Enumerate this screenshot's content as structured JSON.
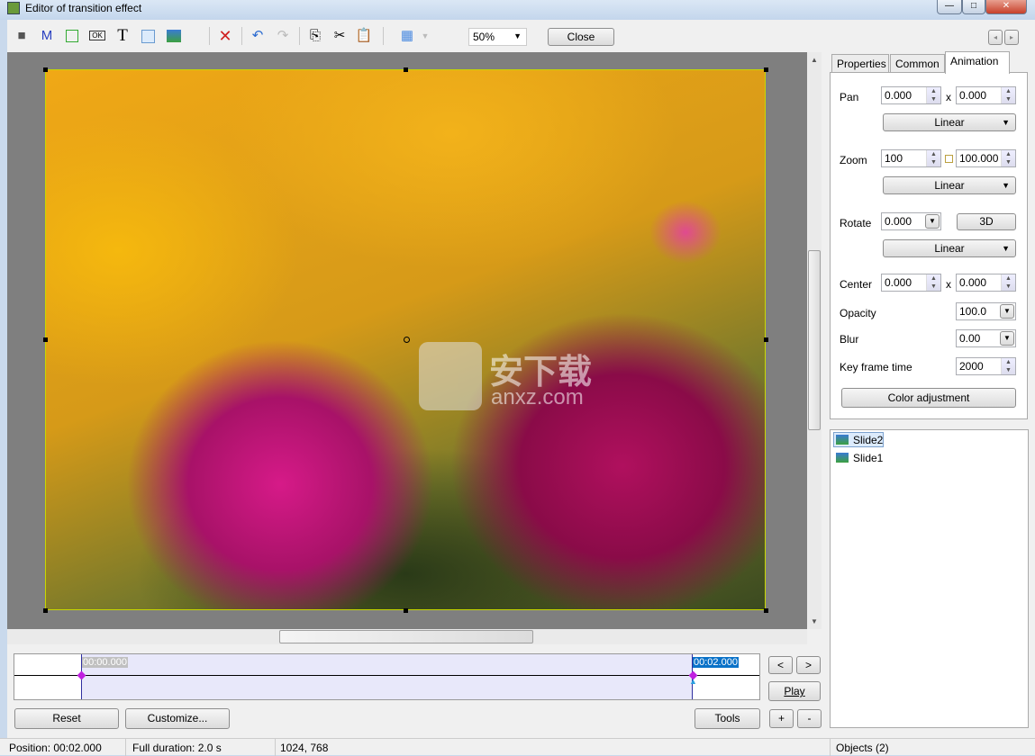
{
  "window": {
    "title": "Editor of transition effect",
    "minimize": "—",
    "maximize": "□",
    "close": "✕"
  },
  "toolbar": {
    "icons": [
      "camera-icon",
      "mask-icon",
      "rectangle-icon",
      "button-icon",
      "text-icon",
      "frame-icon",
      "image-icon",
      "delete-icon",
      "undo-icon",
      "redo-icon",
      "copy-icon",
      "cut-icon",
      "paste-icon",
      "grid-icon"
    ],
    "m_label": "M",
    "t_label": "T",
    "ok_label": "OK",
    "zoom": "50%",
    "close_label": "Close"
  },
  "watermark": {
    "text": "安下载",
    "sub": "anxz.com"
  },
  "tabs": [
    {
      "label": "Properties"
    },
    {
      "label": "Common"
    },
    {
      "label": "Animation",
      "active": true
    }
  ],
  "animation": {
    "pan": {
      "label": "Pan",
      "x": "0.000",
      "sep": "x",
      "y": "0.000",
      "mode": "Linear"
    },
    "zoom": {
      "label": "Zoom",
      "x": "100",
      "y": "100.000",
      "mode": "Linear"
    },
    "rotate": {
      "label": "Rotate",
      "value": "0.000",
      "button": "3D",
      "mode": "Linear"
    },
    "center": {
      "label": "Center",
      "x": "0.000",
      "sep": "x",
      "y": "0.000"
    },
    "opacity": {
      "label": "Opacity",
      "value": "100.0"
    },
    "blur": {
      "label": "Blur",
      "value": "0.00"
    },
    "keyframe": {
      "label": "Key frame time",
      "value": "2000"
    },
    "color_button": "Color adjustment"
  },
  "objects": [
    {
      "label": "Slide2",
      "selected": true
    },
    {
      "label": "Slide1"
    }
  ],
  "timeline": {
    "start": "00:00.000",
    "end": "00:02.000",
    "prev": "<",
    "next": ">",
    "play": "Play",
    "plus": "+",
    "minus": "-"
  },
  "buttons": {
    "reset": "Reset",
    "customize": "Customize...",
    "tools": "Tools"
  },
  "status": {
    "position": "Position:  00:02.000",
    "duration": "Full duration:  2.0 s",
    "size": "1024, 768",
    "objects": "Objects (2)"
  },
  "colors": {
    "accent": "#0a72c8",
    "timeline_fill": "#e8e8fa",
    "keyframe": "#c020e0"
  }
}
